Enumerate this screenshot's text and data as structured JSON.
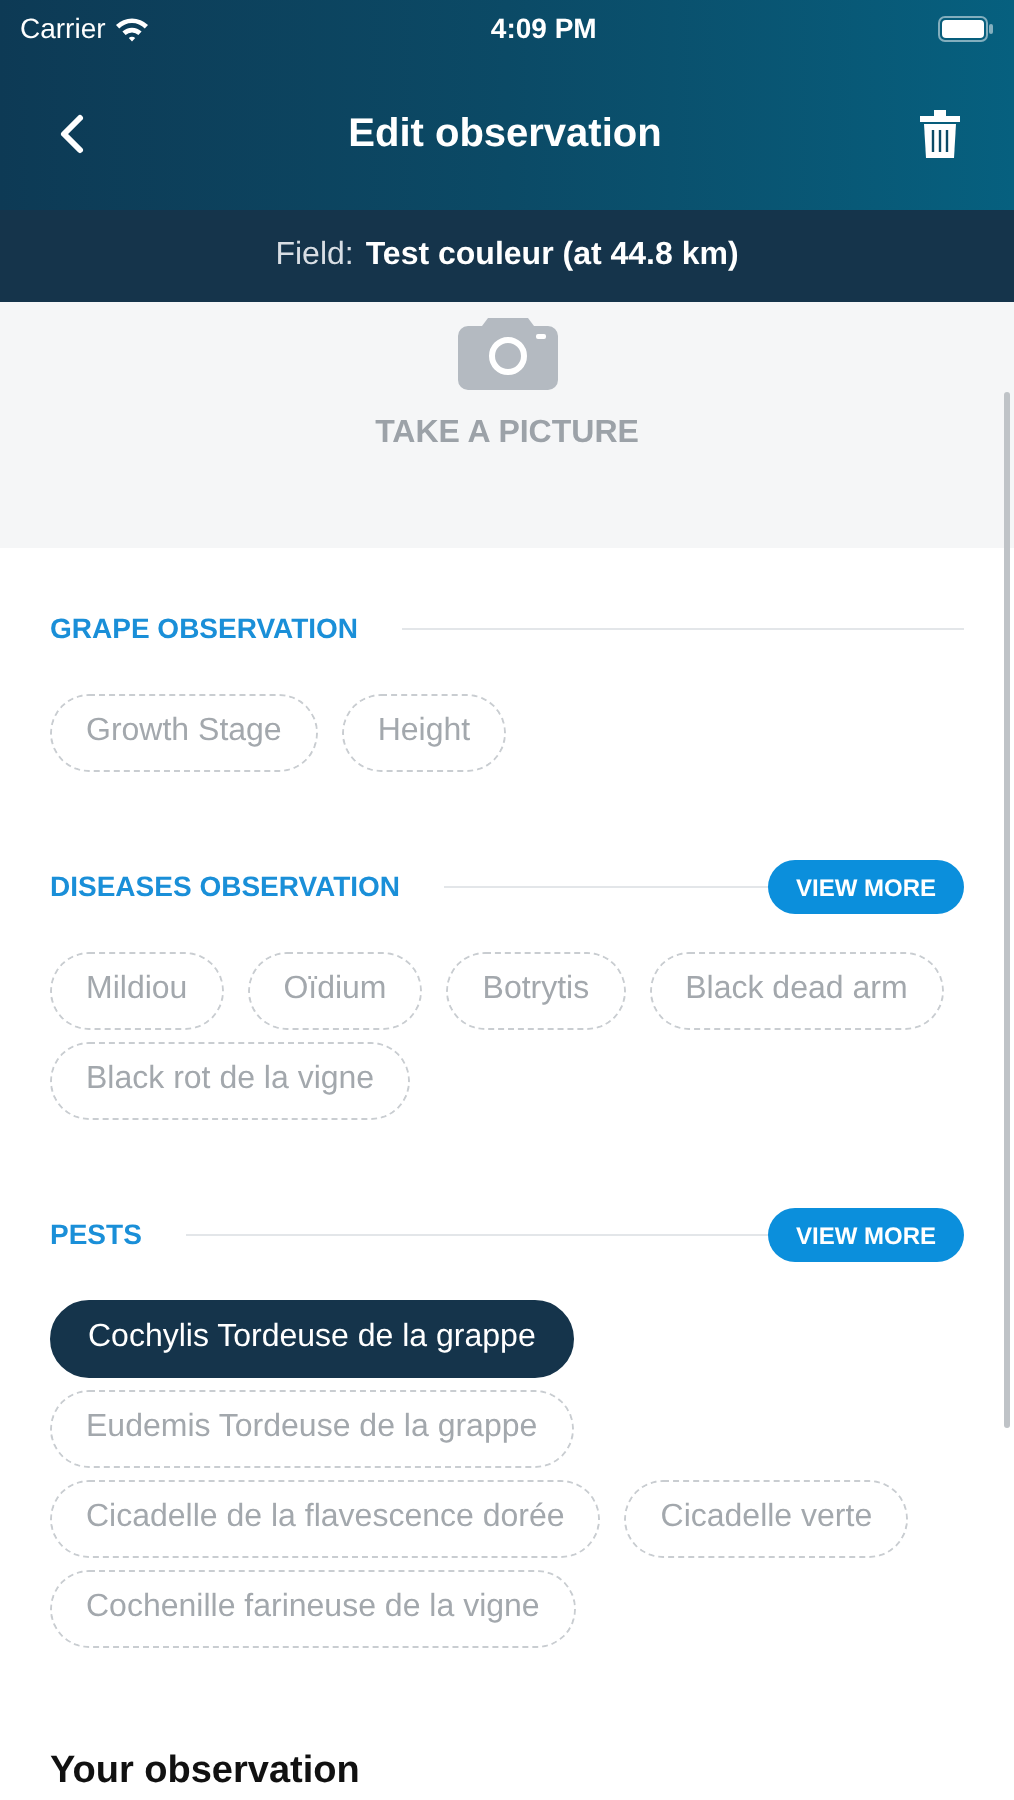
{
  "status_bar": {
    "carrier": "Carrier",
    "time": "4:09 PM"
  },
  "nav": {
    "title": "Edit observation"
  },
  "field": {
    "label": "Field:",
    "value": "Test couleur (at 44.8 km)"
  },
  "picture": {
    "label": "TAKE A PICTURE"
  },
  "sections": [
    {
      "title": "GRAPE OBSERVATION",
      "chips": [
        {
          "label": "Growth Stage",
          "selected": false
        },
        {
          "label": "Height",
          "selected": false
        }
      ]
    },
    {
      "title": "DISEASES OBSERVATION",
      "button": "VIEW MORE",
      "chips": [
        {
          "label": "Mildiou",
          "selected": false
        },
        {
          "label": "Oïdium",
          "selected": false
        },
        {
          "label": "Botrytis",
          "selected": false
        },
        {
          "label": "Black dead arm",
          "selected": false
        },
        {
          "label": "Black rot de la vigne",
          "selected": false
        }
      ]
    },
    {
      "title": "PESTS",
      "button": "VIEW MORE",
      "chips": [
        {
          "label": "Cochylis Tordeuse de la grappe",
          "selected": true
        },
        {
          "label": "Eudemis Tordeuse de la grappe",
          "selected": false
        },
        {
          "label": "Cicadelle de la flavescence dorée",
          "selected": false
        },
        {
          "label": "Cicadelle verte",
          "selected": false
        },
        {
          "label": "Cochenille farineuse de la vigne",
          "selected": false
        }
      ]
    }
  ],
  "observation": {
    "title": "Your observation"
  }
}
